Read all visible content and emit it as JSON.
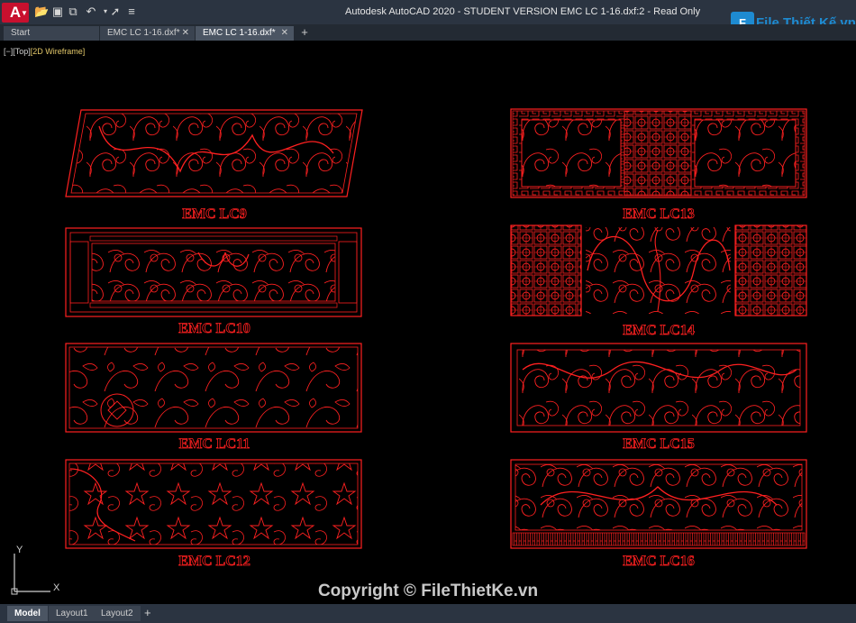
{
  "titlebar": {
    "app_logo": "A",
    "quick_access_icons": [
      "open-folder-icon",
      "save-icon",
      "save-as-icon",
      "undo-icon",
      "redo-icon",
      "share-icon",
      "customize-dropdown-icon"
    ],
    "title": "Autodesk AutoCAD 2020 - STUDENT VERSION    EMC LC 1-16.dxf:2 - Read Only"
  },
  "brand": {
    "mark": "F",
    "text": "File Thiết Kế.vn"
  },
  "tabs": [
    {
      "label": "Start",
      "closable": false,
      "active": false
    },
    {
      "label": "EMC LC 1-16.dxf*",
      "closable": true,
      "active": false
    },
    {
      "label": "EMC LC 1-16.dxf*",
      "closable": true,
      "active": true
    }
  ],
  "tab_add": "+",
  "view_controls": {
    "minus": "[−]",
    "view": "[Top]",
    "style": "[2D Wireframe]"
  },
  "panels": [
    {
      "label": "EMC LC9"
    },
    {
      "label": "EMC LC10"
    },
    {
      "label": "EMC LC11"
    },
    {
      "label": "EMC LC12"
    },
    {
      "label": "EMC LC13"
    },
    {
      "label": "EMC LC14"
    },
    {
      "label": "EMC LC15"
    },
    {
      "label": "EMC LC16"
    }
  ],
  "colors": {
    "drawing": "#ff2020",
    "background": "#000000",
    "chrome": "#2b3441"
  },
  "watermark": "Copyright © FileThietKe.vn",
  "ucs": {
    "x": "X",
    "y": "Y"
  },
  "layout_tabs": [
    {
      "label": "Model",
      "active": true
    },
    {
      "label": "Layout1",
      "active": false
    },
    {
      "label": "Layout2",
      "active": false
    }
  ],
  "layout_add": "+"
}
